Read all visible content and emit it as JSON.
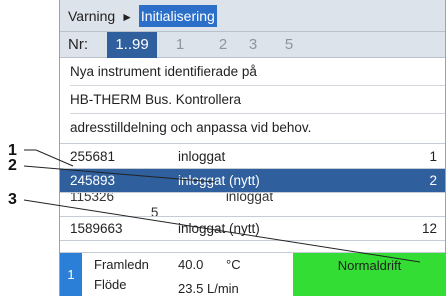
{
  "breadcrumb": {
    "parent": "Varning",
    "separator": "►",
    "current": "Initialisering"
  },
  "tabs": {
    "prefix": "Nr:",
    "items": [
      "1..99",
      "1",
      "2",
      "3",
      "5"
    ]
  },
  "message": {
    "lines": [
      "Nya instrument identifierade på",
      "HB-THERM Bus. Kontrollera",
      "adresstilldelning och anpassa vid behov."
    ]
  },
  "devices": [
    {
      "id": "255681",
      "status": "inloggat",
      "num": "1"
    },
    {
      "id": "245893",
      "status": "inloggat (nytt)",
      "num": "2"
    },
    {
      "id": "115326",
      "status": "inloggat",
      "num": "5"
    },
    {
      "id": "1589663",
      "status": "inloggat (nytt)",
      "num": "12"
    }
  ],
  "statusbar": {
    "module_number": "1",
    "label1": "Framledn",
    "value1": "40.0",
    "unit1": "°C",
    "label2": "Flöde",
    "value2": "23.5",
    "unit2": "L/min",
    "mode": "Normaldrift"
  },
  "callouts": [
    "1",
    "2",
    "3"
  ],
  "colors": {
    "selection": "#2f5f9c",
    "breadcrumb_highlight": "#2b6fc9",
    "module_badge": "#2b7fd6",
    "mode_normal": "#33dd33",
    "header_bg": "#dde3ea"
  }
}
